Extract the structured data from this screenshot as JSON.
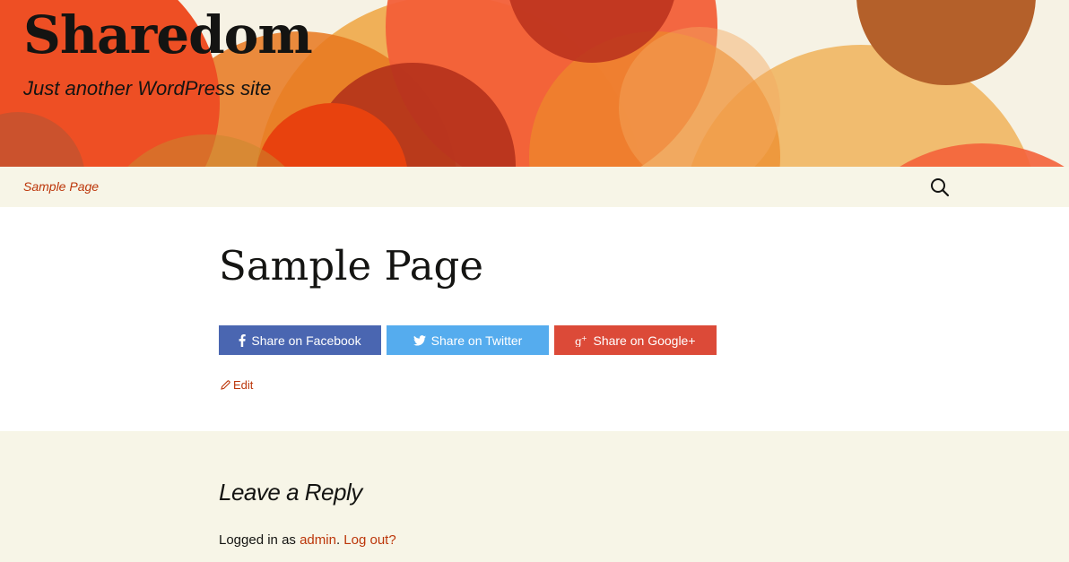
{
  "header": {
    "site_title": "Sharedom",
    "site_description": "Just another WordPress site"
  },
  "nav": {
    "items": [
      {
        "label": "Sample Page"
      }
    ],
    "search_icon": "search-icon"
  },
  "page": {
    "title": "Sample Page",
    "share_buttons": [
      {
        "label": "Share on Facebook",
        "icon": "facebook-icon",
        "color": "#4a66b1"
      },
      {
        "label": "Share on Twitter",
        "icon": "twitter-icon",
        "color": "#55acee"
      },
      {
        "label": "Share on Google+",
        "icon": "google-plus-icon",
        "color": "#dc4a38"
      }
    ],
    "edit_label": "Edit"
  },
  "comments": {
    "reply_title": "Leave a Reply",
    "logged_in_prefix": "Logged in as ",
    "user": "admin",
    "separator": ". ",
    "logout_label": "Log out?"
  },
  "colors": {
    "accent": "#bc360a",
    "header_bg": "#f6f2e4",
    "nav_bg": "#f7f5e7"
  }
}
